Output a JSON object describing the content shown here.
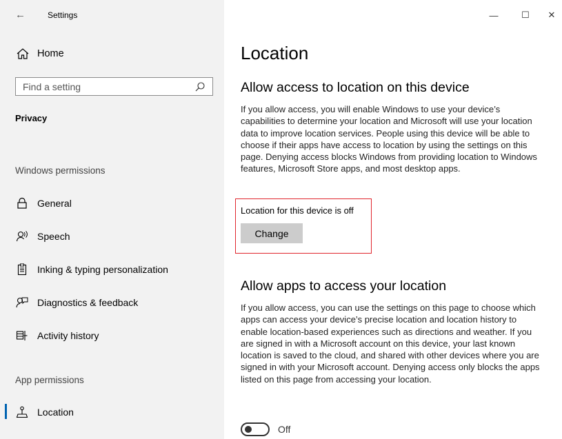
{
  "window": {
    "app_title": "Settings",
    "controls": {
      "minimize": "—",
      "maximize": "☐",
      "close": "✕"
    }
  },
  "sidebar": {
    "home_label": "Home",
    "search_placeholder": "Find a setting",
    "section_title": "Privacy",
    "groups": [
      {
        "label": "Windows permissions",
        "items": [
          {
            "label": "General",
            "icon": "lock-icon"
          },
          {
            "label": "Speech",
            "icon": "speech-icon"
          },
          {
            "label": "Inking & typing personalization",
            "icon": "clipboard-icon"
          },
          {
            "label": "Diagnostics & feedback",
            "icon": "feedback-icon"
          },
          {
            "label": "Activity history",
            "icon": "activity-icon"
          }
        ]
      },
      {
        "label": "App permissions",
        "items": [
          {
            "label": "Location",
            "icon": "location-icon",
            "selected": true
          }
        ]
      }
    ]
  },
  "main": {
    "page_title": "Location",
    "device_section": {
      "heading": "Allow access to location on this device",
      "description": "If you allow access, you will enable Windows to use your device’s capabilities to determine your location and Microsoft will use your location data to improve location services. People using this device will be able to choose if their apps have access to location by using the settings on this page. Denying access blocks Windows from providing location to Windows features, Microsoft Store apps, and most desktop apps.",
      "status": "Location for this device is off",
      "button_label": "Change"
    },
    "apps_section": {
      "heading": "Allow apps to access your location",
      "description": "If you allow access, you can use the settings on this page to choose which apps can access your device’s precise location and location history to enable location-based experiences such as directions and weather. If you are signed in with a Microsoft account on this device, your last known location is saved to the cloud, and shared with other devices where you are signed in with your Microsoft account. Denying access only blocks the apps listed on this page from accessing your location.",
      "toggle_label": "Off",
      "toggle_on": false
    }
  },
  "colors": {
    "sidebar_bg": "#f2f2f2",
    "accent": "#0063b1",
    "highlight_border": "#e0242b",
    "button_bg": "#cccccc"
  }
}
